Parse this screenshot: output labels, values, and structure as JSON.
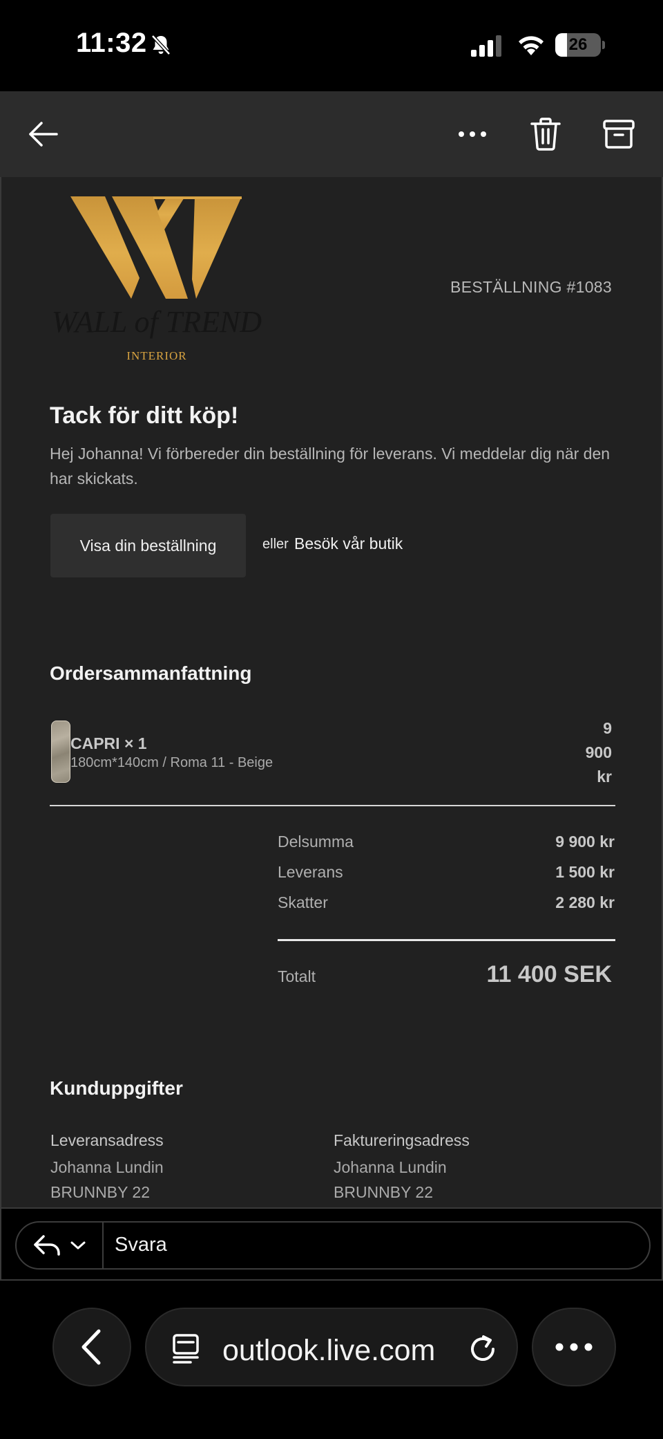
{
  "status_bar": {
    "time": "11:32",
    "battery": "26",
    "battery_level": 0.26,
    "icons": [
      "bell-slash-icon",
      "cellular-signal-icon",
      "wifi-icon",
      "battery-icon"
    ]
  },
  "toolbar": {
    "icons": [
      "back-arrow-icon",
      "more-horizontal-icon",
      "trash-icon",
      "archive-icon"
    ]
  },
  "email": {
    "logo": {
      "brand": "WALL of TREND",
      "sub": "INTERIOR",
      "gold": "#d9a441"
    },
    "order_number": "BESTÄLLNING #1083",
    "thanks_title": "Tack för ditt köp!",
    "thanks_text": "Hej Johanna! Vi förbereder din beställning för leverans. Vi meddelar dig när den har skickats.",
    "view_order_label": "Visa din beställning",
    "or_label": "eller",
    "visit_store_label": "Besök vår butik",
    "summary": {
      "title": "Ordersammanfattning",
      "item": {
        "name": "CAPRI × 1",
        "variant": "180cm*140cm / Roma 11 - Beige",
        "price_lines": [
          "9",
          "900",
          "kr"
        ]
      },
      "rows": [
        {
          "label": "Delsumma",
          "value": "9 900 kr"
        },
        {
          "label": "Leverans",
          "value": "1 500 kr"
        },
        {
          "label": "Skatter",
          "value": "2 280 kr"
        }
      ],
      "total_label": "Totalt",
      "total_value": "11 400 SEK"
    },
    "customer": {
      "title": "Kunduppgifter",
      "shipping": {
        "heading": "Leveransadress",
        "name": "Johanna Lundin",
        "street": "BRUNNBY 22"
      },
      "billing": {
        "heading": "Faktureringsadress",
        "name": "Johanna Lundin",
        "street": "BRUNNBY 22"
      }
    }
  },
  "reply": {
    "placeholder": "Svara"
  },
  "browser": {
    "url": "outlook.live.com"
  }
}
